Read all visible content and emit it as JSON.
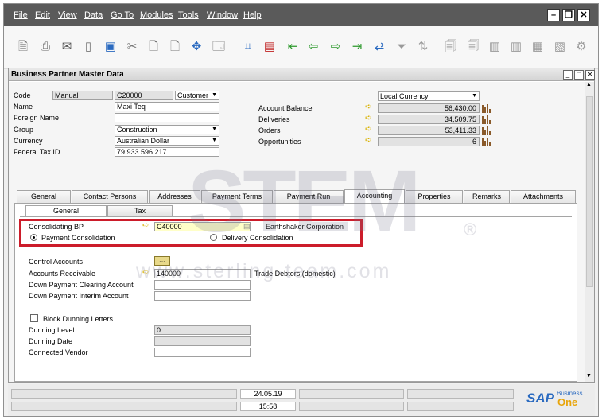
{
  "menu": [
    "File",
    "Edit",
    "View",
    "Data",
    "Go To",
    "Modules",
    "Tools",
    "Window",
    "Help"
  ],
  "window_title": "Business Partner Master Data",
  "header": {
    "code_label": "Code",
    "code_series": "Manual",
    "code_value": "C20000",
    "bp_type": "Customer",
    "name_label": "Name",
    "name_value": "Maxi Teq",
    "foreign_name_label": "Foreign Name",
    "foreign_name_value": "",
    "group_label": "Group",
    "group_value": "Construction",
    "currency_label": "Currency",
    "currency_value": "Australian Dollar",
    "federal_tax_label": "Federal Tax ID",
    "federal_tax_value": "79 933 596 217",
    "currency_select": "Local Currency",
    "balances": [
      {
        "label": "Account Balance",
        "value": "56,430.00"
      },
      {
        "label": "Deliveries",
        "value": "34,509.75"
      },
      {
        "label": "Orders",
        "value": "53,411.33"
      },
      {
        "label": "Opportunities",
        "value": "6"
      }
    ]
  },
  "tabs": [
    "General",
    "Contact Persons",
    "Addresses",
    "Payment Terms",
    "Payment Run",
    "Accounting",
    "Properties",
    "Remarks",
    "Attachments"
  ],
  "active_tab": "Accounting",
  "subtabs": [
    "General",
    "Tax"
  ],
  "accounting": {
    "consolidating_bp_label": "Consolidating BP",
    "consolidating_bp_value": "C40000",
    "consolidating_bp_name": "Earthshaker Corporation",
    "payment_consolidation": "Payment Consolidation",
    "delivery_consolidation": "Delivery Consolidation",
    "control_accounts_label": "Control Accounts",
    "control_accounts_btn": "...",
    "accounts_receivable_label": "Accounts Receivable",
    "accounts_receivable_value": "140000",
    "accounts_receivable_name": "Trade Debtors (domestic)",
    "dp_clearing_label": "Down Payment Clearing Account",
    "dp_interim_label": "Down Payment Interim Account",
    "block_dunning_label": "Block Dunning Letters",
    "dunning_level_label": "Dunning Level",
    "dunning_level_value": "0",
    "dunning_date_label": "Dunning Date",
    "connected_vendor_label": "Connected Vendor"
  },
  "watermark": {
    "brand": "STEM",
    "registered": "®",
    "url": "www.sterling-team.com"
  },
  "status": {
    "date": "24.05.19",
    "time": "15:58",
    "logo_sap": "SAP",
    "logo_business": "Business",
    "logo_one": "One"
  },
  "icons": [
    "print-preview-icon",
    "print-icon",
    "email-icon",
    "sms-icon",
    "fax-icon",
    "export-excel-icon",
    "export-word-icon",
    "export-pdf-icon",
    "launch-app-icon",
    "lock-screen-icon",
    "find-icon",
    "add-icon",
    "first-record-icon",
    "previous-record-icon",
    "next-record-icon",
    "last-record-icon",
    "refresh-icon",
    "filter-icon",
    "sort-icon",
    "base-document-icon",
    "target-document-icon",
    "gross-profit-icon",
    "payment-means-icon",
    "transaction-journal-icon",
    "settings-icon"
  ],
  "colors": {
    "menubar": "#5a5a5a",
    "highlight_box": "#cc1c2a",
    "link_arrow": "#d9b200"
  }
}
